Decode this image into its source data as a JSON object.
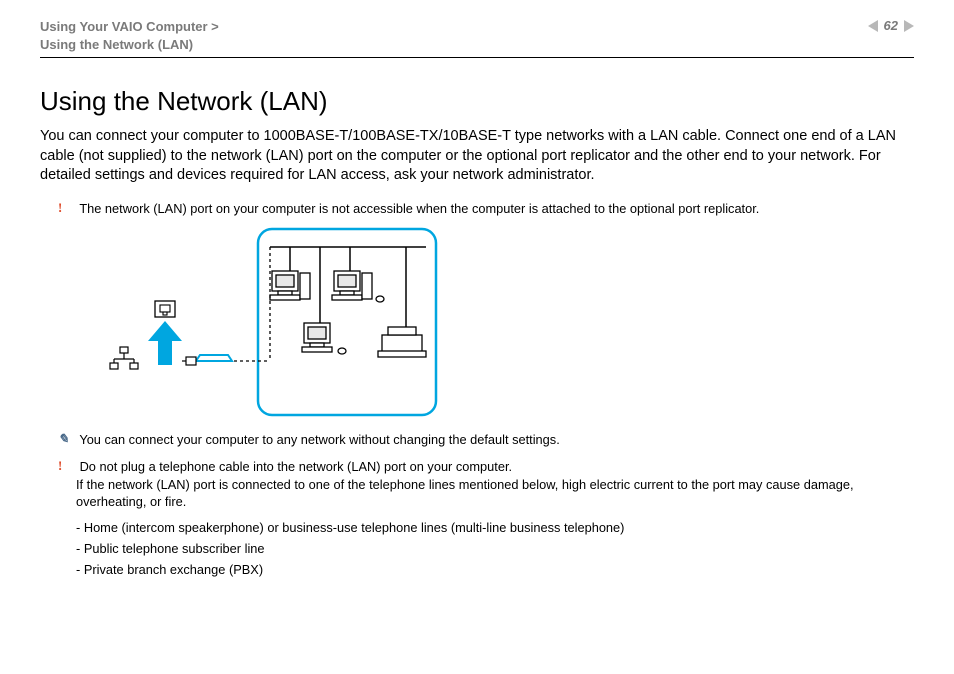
{
  "header": {
    "breadcrumb_line1": "Using Your VAIO Computer >",
    "breadcrumb_line2": "Using the Network (LAN)",
    "page_number": "62"
  },
  "title": "Using the Network (LAN)",
  "intro": "You can connect your computer to 1000BASE-T/100BASE-TX/10BASE-T type networks with a LAN cable. Connect one end of a LAN cable (not supplied) to the network (LAN) port on the computer or the optional port replicator and the other end to your network. For detailed settings and devices required for LAN access, ask your network administrator.",
  "warn1": "The network (LAN) port on your computer is not accessible when the computer is attached to the optional port replicator.",
  "tip1": "You can connect your computer to any network without changing the default settings.",
  "warn2_line1": "Do not plug a telephone cable into the network (LAN) port on your computer.",
  "warn2_line2": "If the network (LAN) port is connected to one of the telephone lines mentioned below, high electric current to the port may cause damage, overheating, or fire.",
  "bullets": [
    "Home (intercom speakerphone) or business-use telephone lines (multi-line business telephone)",
    "Public telephone subscriber line",
    "Private branch exchange (PBX)"
  ],
  "marks": {
    "warn": "!",
    "tip": "✎"
  }
}
